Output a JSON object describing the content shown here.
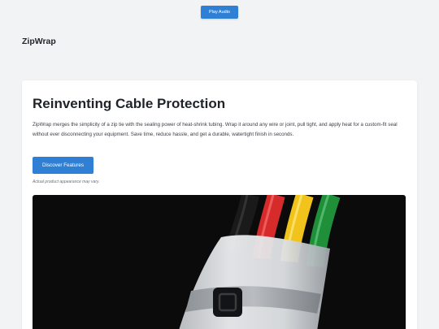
{
  "audio": {
    "label": "Play Audio"
  },
  "brand": {
    "name": "ZipWrap"
  },
  "hero": {
    "title": "Reinventing Cable Protection",
    "description": "ZipWrap merges the simplicity of a zip tie with the sealing power of heat-shrink tubing. Wrap it around any wire or joint, pull tight, and apply heat for a custom-fit seal without ever disconnecting your equipment. Save time, reduce hassle, and get a durable, watertight finish in seconds.",
    "cta_label": "Discover Features",
    "note": "Actual product appearance may vary."
  },
  "colors": {
    "accent": "#2f80d4",
    "page_bg": "#f2f3f5",
    "wire_black": "#1a1a1a",
    "wire_red": "#d62b2b",
    "wire_yellow": "#f1c31b",
    "wire_green": "#1f8f3a"
  }
}
